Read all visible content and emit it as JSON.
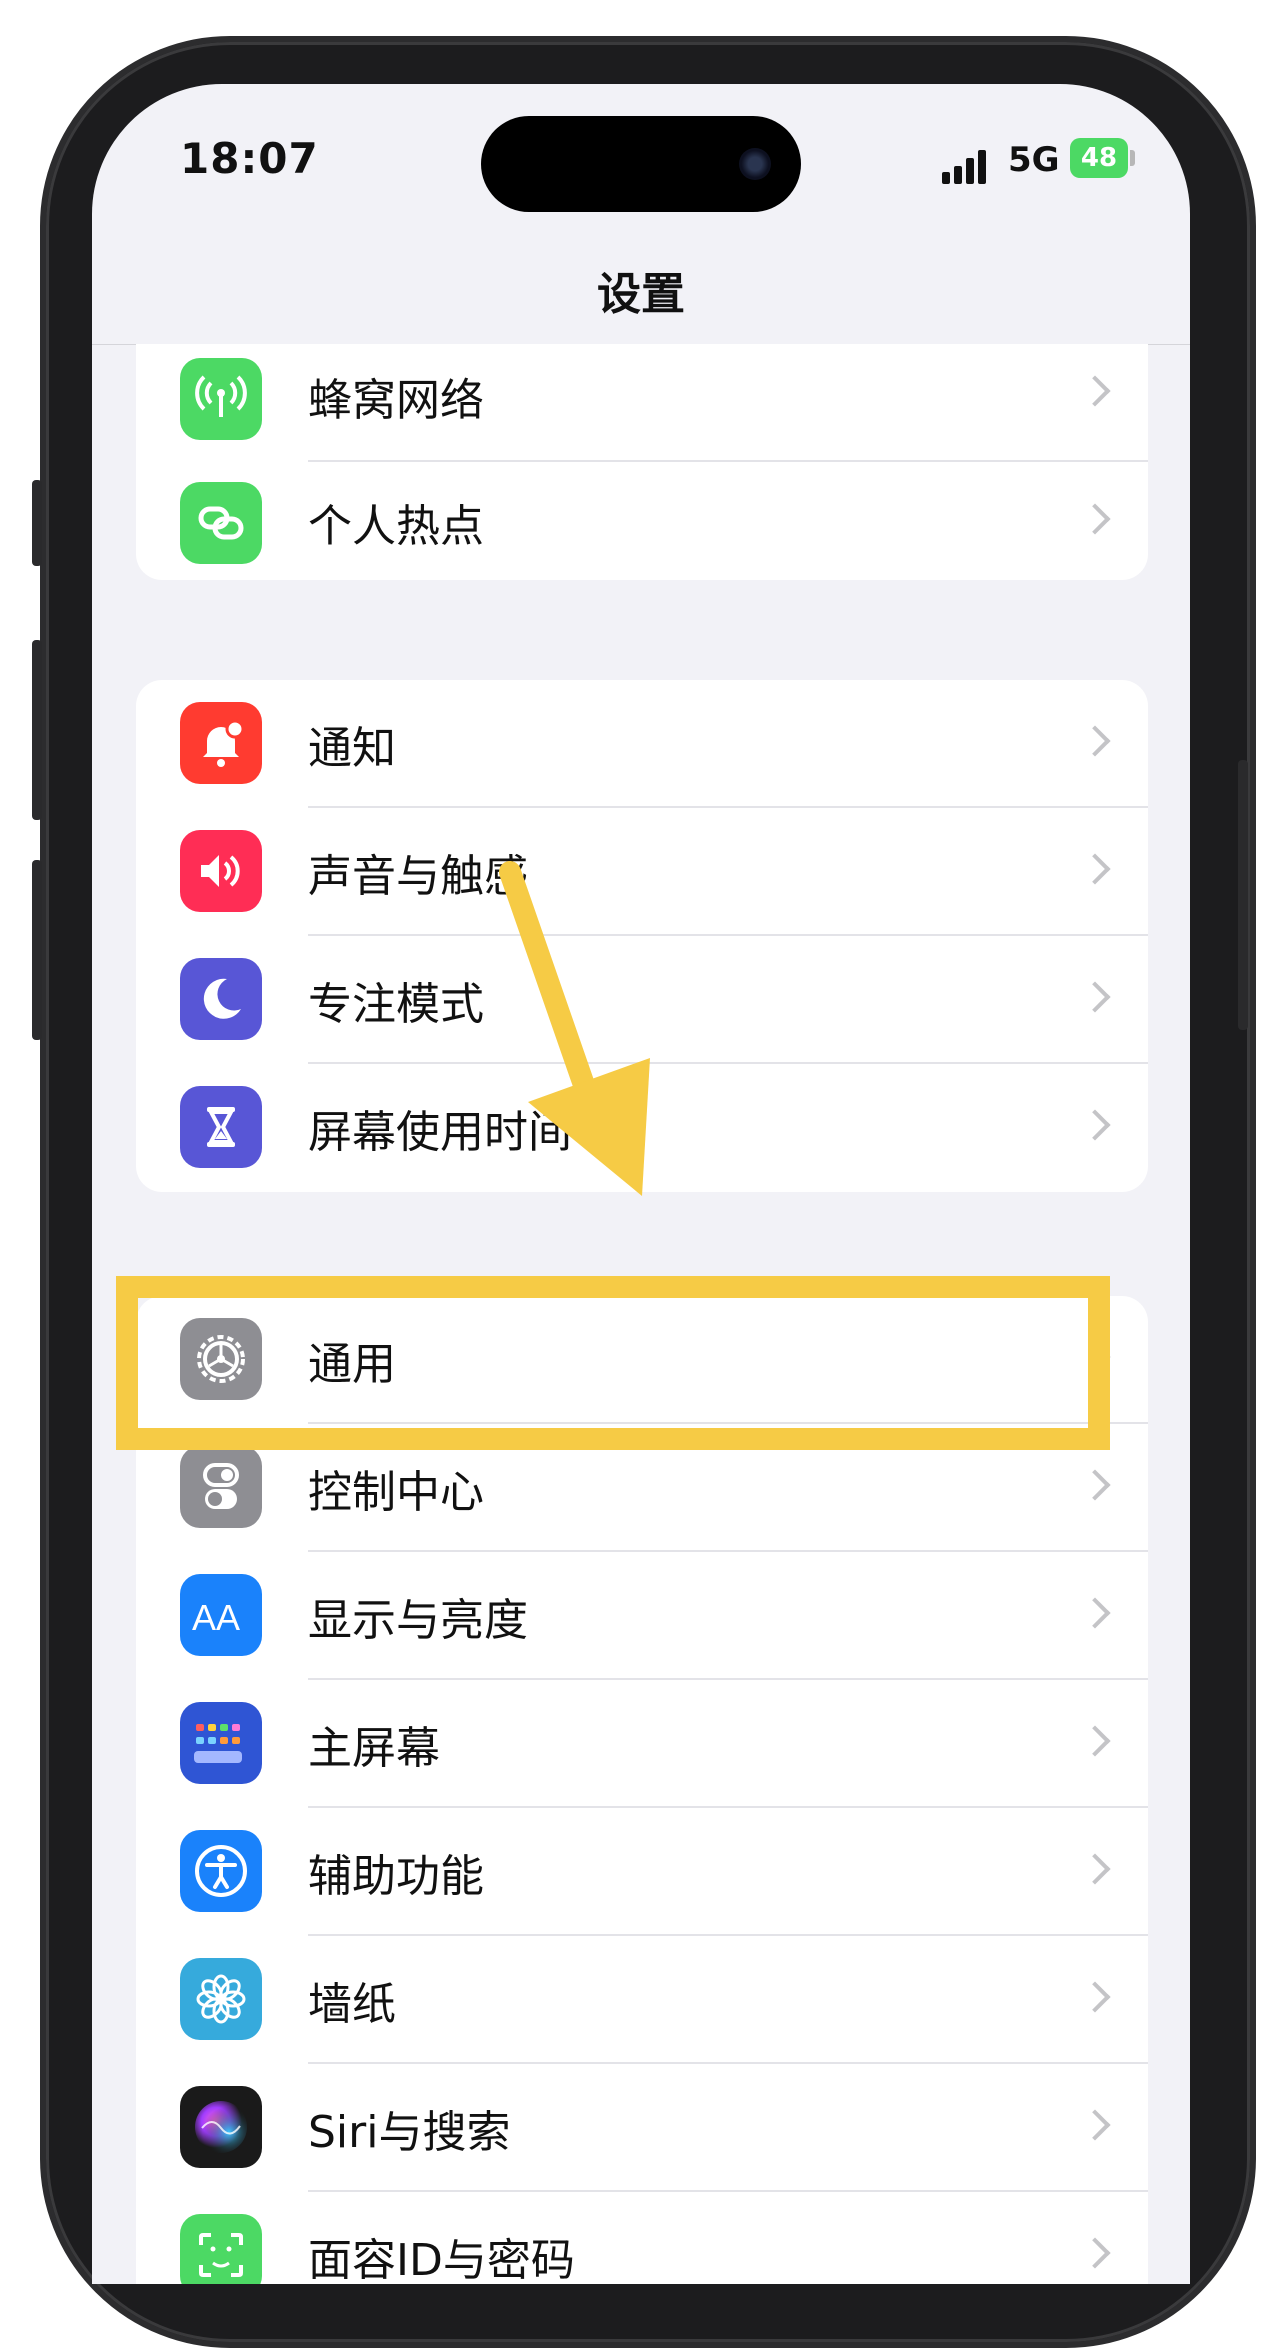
{
  "status_bar": {
    "time": "18:07",
    "network": "5G",
    "battery": "48"
  },
  "nav": {
    "title": "设置"
  },
  "groups": [
    {
      "items": [
        {
          "label": "蜂窝网络",
          "icon": "cellular-icon",
          "color": "#4cd964"
        },
        {
          "label": "个人热点",
          "icon": "hotspot-icon",
          "color": "#4cd964"
        }
      ]
    },
    {
      "items": [
        {
          "label": "通知",
          "icon": "notification-bell-icon",
          "color": "#ff3b30"
        },
        {
          "label": "声音与触感",
          "icon": "speaker-icon",
          "color": "#ff2d55"
        },
        {
          "label": "专注模式",
          "icon": "moon-icon",
          "color": "#5856d6"
        },
        {
          "label": "屏幕使用时间",
          "icon": "hourglass-icon",
          "color": "#5856d6"
        }
      ]
    },
    {
      "items": [
        {
          "label": "通用",
          "icon": "gear-icon",
          "color": "#8e8e93"
        },
        {
          "label": "控制中心",
          "icon": "toggle-switches-icon",
          "color": "#8e8e93"
        },
        {
          "label": "显示与亮度",
          "icon": "aa-text-icon",
          "color": "#1a82fb"
        },
        {
          "label": "主屏幕",
          "icon": "home-grid-icon",
          "color": "#2f55d4"
        },
        {
          "label": "辅助功能",
          "icon": "accessibility-icon",
          "color": "#1a82fb"
        },
        {
          "label": "墙纸",
          "icon": "flower-icon",
          "color": "#36aadc"
        },
        {
          "label": "Siri与搜索",
          "icon": "siri-orb-icon",
          "color": "#222222"
        },
        {
          "label": "面容ID与密码",
          "icon": "face-id-icon",
          "color": "#4cd964"
        }
      ]
    }
  ],
  "annotation": {
    "highlight_color": "#f6cb45",
    "arrow_color": "#f6cb45"
  }
}
